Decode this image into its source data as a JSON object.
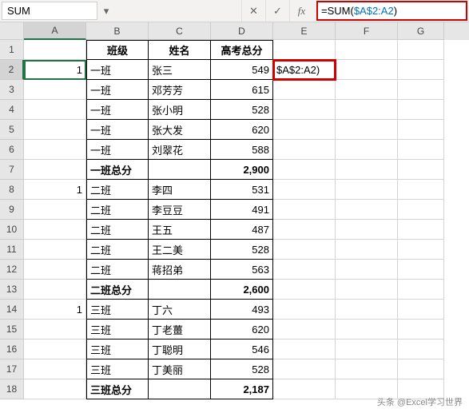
{
  "name_box": "SUM",
  "formula_prefix": "=SUM(",
  "formula_ref": "$A$2:A2",
  "formula_suffix": ")",
  "editing_cell_display": "$A$2:A2)",
  "columns": [
    "A",
    "B",
    "C",
    "D",
    "E",
    "F",
    "G"
  ],
  "selected_col": "A",
  "selected_row": 2,
  "headers": {
    "B": "班级",
    "C": "姓名",
    "D": "高考总分"
  },
  "rows": [
    {
      "n": 1
    },
    {
      "n": 2,
      "A": "1",
      "B": "一班",
      "C": "张三",
      "D": "549"
    },
    {
      "n": 3,
      "B": "一班",
      "C": "邓芳芳",
      "D": "615"
    },
    {
      "n": 4,
      "B": "一班",
      "C": "张小明",
      "D": "528"
    },
    {
      "n": 5,
      "B": "一班",
      "C": "张大发",
      "D": "620"
    },
    {
      "n": 6,
      "B": "一班",
      "C": "刘翠花",
      "D": "588"
    },
    {
      "n": 7,
      "B": "一班总分",
      "D": "2,900",
      "bold": true
    },
    {
      "n": 8,
      "A": "1",
      "B": "二班",
      "C": "李四",
      "D": "531"
    },
    {
      "n": 9,
      "B": "二班",
      "C": "李豆豆",
      "D": "491"
    },
    {
      "n": 10,
      "B": "二班",
      "C": "王五",
      "D": "487"
    },
    {
      "n": 11,
      "B": "二班",
      "C": "王二美",
      "D": "528"
    },
    {
      "n": 12,
      "B": "二班",
      "C": "蒋招弟",
      "D": "563"
    },
    {
      "n": 13,
      "B": "二班总分",
      "D": "2,600",
      "bold": true
    },
    {
      "n": 14,
      "A": "1",
      "B": "三班",
      "C": "丁六",
      "D": "493"
    },
    {
      "n": 15,
      "B": "三班",
      "C": "丁老薑",
      "D": "620"
    },
    {
      "n": 16,
      "B": "三班",
      "C": "丁聪明",
      "D": "546"
    },
    {
      "n": 17,
      "B": "三班",
      "C": "丁美丽",
      "D": "528"
    },
    {
      "n": 18,
      "B": "三班总分",
      "D": "2,187",
      "bold": true
    }
  ],
  "icons": {
    "cancel": "✕",
    "accept": "✓",
    "fx": "fx",
    "dropdown": "▾"
  },
  "watermark": "头条 @Excel学习世界",
  "chart_data": {
    "type": "table",
    "title": "",
    "columns": [
      "班级",
      "姓名",
      "高考总分"
    ],
    "data": [
      [
        "一班",
        "张三",
        549
      ],
      [
        "一班",
        "邓芳芳",
        615
      ],
      [
        "一班",
        "张小明",
        528
      ],
      [
        "一班",
        "张大发",
        620
      ],
      [
        "一班",
        "刘翠花",
        588
      ],
      [
        "一班总分",
        "",
        2900
      ],
      [
        "二班",
        "李四",
        531
      ],
      [
        "二班",
        "李豆豆",
        491
      ],
      [
        "二班",
        "王五",
        487
      ],
      [
        "二班",
        "王二美",
        528
      ],
      [
        "二班",
        "蒋招弟",
        563
      ],
      [
        "二班总分",
        "",
        2600
      ],
      [
        "三班",
        "丁六",
        493
      ],
      [
        "三班",
        "丁老薑",
        620
      ],
      [
        "三班",
        "丁聪明",
        546
      ],
      [
        "三班",
        "丁美丽",
        528
      ],
      [
        "三班总分",
        "",
        2187
      ]
    ]
  }
}
